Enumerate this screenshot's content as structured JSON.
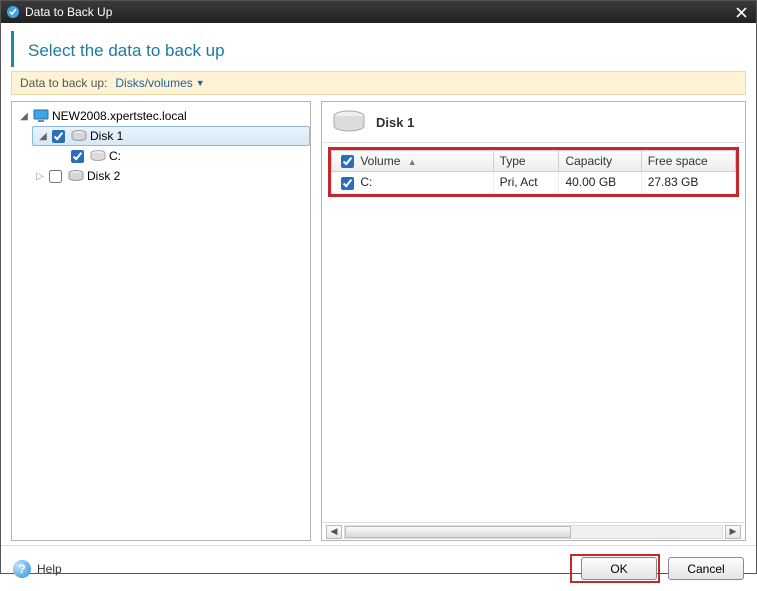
{
  "window": {
    "title": "Data to Back Up"
  },
  "heading": "Select the data to back up",
  "toolbar": {
    "label": "Data to back up:",
    "selection": "Disks/volumes"
  },
  "tree": {
    "root": {
      "label": "NEW2008.xpertstec.local"
    },
    "disk1": {
      "label": "Disk 1"
    },
    "volC": {
      "label": "C:"
    },
    "disk2": {
      "label": "Disk 2"
    }
  },
  "details": {
    "title": "Disk 1",
    "columns": {
      "c1": "Volume",
      "c2": "Type",
      "c3": "Capacity",
      "c4": "Free space"
    },
    "row": {
      "volume": "C:",
      "type": "Pri, Act",
      "capacity": "40.00 GB",
      "free": "27.83 GB"
    }
  },
  "footer": {
    "help": "Help",
    "ok": "OK",
    "cancel": "Cancel"
  }
}
